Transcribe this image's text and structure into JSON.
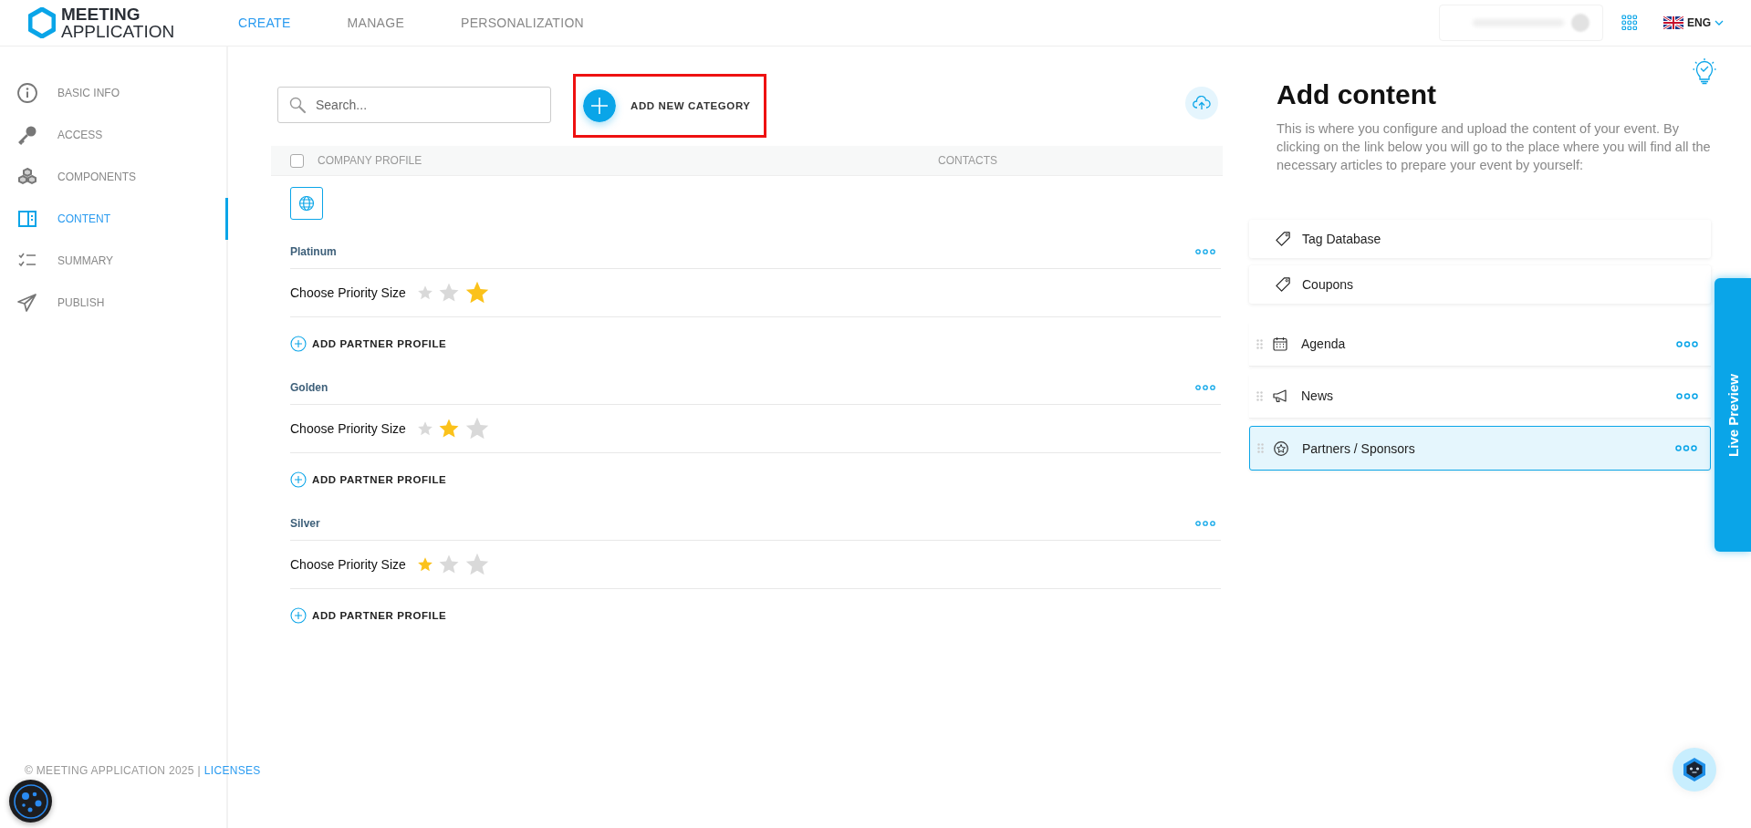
{
  "header": {
    "logo": {
      "line1": "MEETING",
      "line2": "APPLICATION"
    },
    "nav": [
      {
        "label": "CREATE",
        "selected": true
      },
      {
        "label": "MANAGE",
        "selected": false
      },
      {
        "label": "PERSONALIZATION",
        "selected": false
      }
    ],
    "language": "ENG"
  },
  "sidebar": {
    "items": [
      {
        "label": "BASIC INFO",
        "selected": false
      },
      {
        "label": "ACCESS",
        "selected": false
      },
      {
        "label": "COMPONENTS",
        "selected": false
      },
      {
        "label": "CONTENT",
        "selected": true
      },
      {
        "label": "SUMMARY",
        "selected": false
      },
      {
        "label": "PUBLISH",
        "selected": false
      }
    ],
    "footer": {
      "copyright": "© MEETING APPLICATION 2025 |",
      "link": "LICENSES"
    }
  },
  "main": {
    "search": {
      "placeholder": "Search..."
    },
    "add_button": "ADD NEW CATEGORY",
    "table": {
      "select_all_checked": false,
      "columns": [
        "COMPANY PROFILE",
        "CONTACTS"
      ]
    },
    "categories": [
      {
        "name": "Platinum",
        "priority_label": "Choose Priority Size",
        "priority_stars": [
          {
            "selected": false
          },
          {
            "selected": false
          },
          {
            "selected": true
          }
        ],
        "add_label": "ADD PARTNER PROFILE"
      },
      {
        "name": "Golden",
        "priority_label": "Choose Priority Size",
        "priority_stars": [
          {
            "selected": false
          },
          {
            "selected": true
          },
          {
            "selected": false
          }
        ],
        "add_label": "ADD PARTNER PROFILE"
      },
      {
        "name": "Silver",
        "priority_label": "Choose Priority Size",
        "priority_stars": [
          {
            "selected": true
          },
          {
            "selected": false
          },
          {
            "selected": false
          }
        ],
        "add_label": "ADD PARTNER PROFILE"
      }
    ]
  },
  "panel": {
    "title": "Add content",
    "description": "This is where you configure and upload the content of your event. By clicking on the link below you will go to the place where you will find all the necessary articles to prepare your event by yourself:",
    "links": [
      {
        "label": "Tag Database"
      },
      {
        "label": "Coupons"
      }
    ],
    "sections": [
      {
        "label": "Agenda",
        "selected": false
      },
      {
        "label": "News",
        "selected": false
      },
      {
        "label": "Partners / Sponsors",
        "selected": true
      }
    ]
  },
  "live_preview": "Live Preview"
}
